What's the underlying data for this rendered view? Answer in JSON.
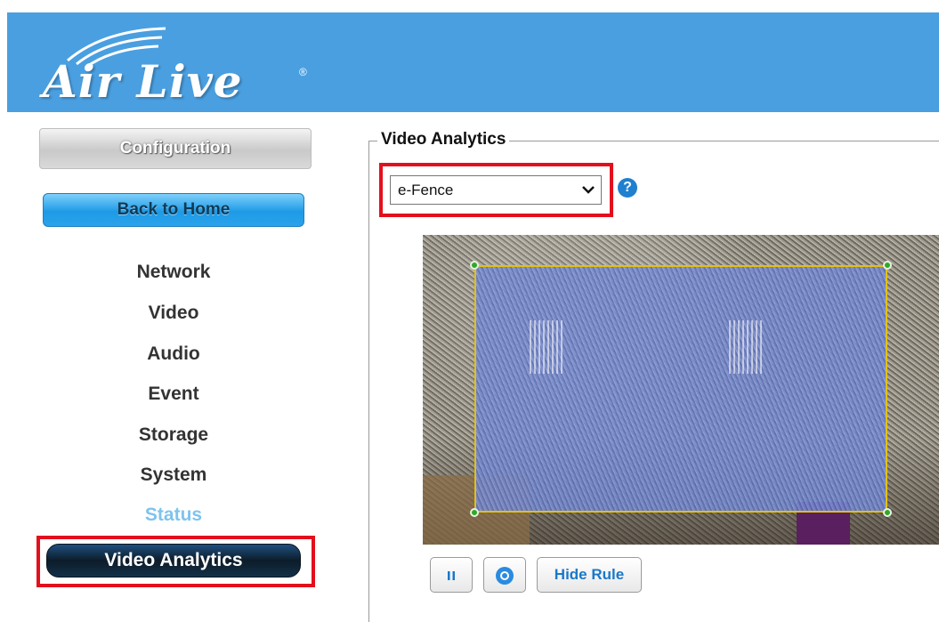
{
  "brand": {
    "logo_text": "Air Live",
    "trademark": "®"
  },
  "sidebar": {
    "configuration_label": "Configuration",
    "back_home_label": "Back to Home",
    "items": [
      {
        "label": "Network"
      },
      {
        "label": "Video"
      },
      {
        "label": "Audio"
      },
      {
        "label": "Event"
      },
      {
        "label": "Storage"
      },
      {
        "label": "System"
      },
      {
        "label": "Status"
      }
    ],
    "active_item": "Video Analytics"
  },
  "main": {
    "section_title": "Video Analytics",
    "mode_select": {
      "selected": "e-Fence"
    },
    "help_icon": "?",
    "controls": {
      "pause_icon": "pause-icon",
      "zoom_icon": "zoom-icon",
      "hide_rule_label": "Hide Rule"
    }
  },
  "colors": {
    "header_blue": "#4a9fe0",
    "highlight_red": "#e3101c",
    "zone_border": "#e2c018",
    "status_link": "#7ec3ee"
  }
}
